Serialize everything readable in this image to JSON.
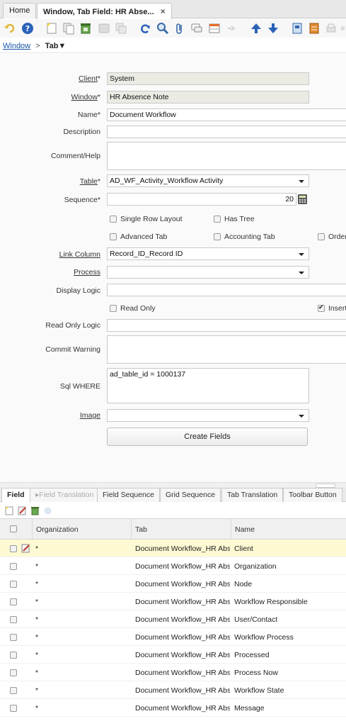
{
  "window_tabs": [
    {
      "label": "Home"
    },
    {
      "label": "Window, Tab Field: HR Abse...",
      "close": "×"
    }
  ],
  "toolbar": {
    "icons": [
      "undo-icon",
      "help-icon",
      "new-record-icon",
      "copy-record-icon",
      "delete-icon",
      "save-icon",
      "save-new-icon",
      "refresh-icon",
      "find-icon",
      "attachment-icon",
      "chat-icon",
      "grid-toggle-icon",
      "detail-icon",
      "previous-record-icon",
      "next-record-icon",
      "report-icon",
      "archive-icon",
      "print-icon",
      "more-icon"
    ]
  },
  "breadcrumb": {
    "root": "Window",
    "sep": ">",
    "current": "Tab▼"
  },
  "form": {
    "client": {
      "label": "Client",
      "req": "*",
      "value": "System"
    },
    "window": {
      "label": "Window",
      "req": "*",
      "value": "HR Absence Note"
    },
    "name": {
      "label": "Name",
      "req": "*",
      "value": "Document Workflow"
    },
    "description": {
      "label": "Description",
      "value": ""
    },
    "comment": {
      "label": "Comment/Help",
      "value": ""
    },
    "table": {
      "label": "Table",
      "req": "*",
      "value": "AD_WF_Activity_Workflow Activity"
    },
    "sequence": {
      "label": "Sequence",
      "req": "*",
      "value": "20"
    },
    "checks_row1": [
      {
        "label": "Single Row Layout",
        "checked": false
      },
      {
        "label": "Has Tree",
        "checked": false
      }
    ],
    "checks_row2": [
      {
        "label": "Advanced Tab",
        "checked": false
      },
      {
        "label": "Accounting Tab",
        "checked": false
      },
      {
        "label": "Order",
        "checked": false
      }
    ],
    "link_column": {
      "label": "Link Column",
      "value": "Record_ID_Record ID"
    },
    "process": {
      "label": "Process",
      "value": ""
    },
    "display_logic": {
      "label": "Display Logic",
      "value": ""
    },
    "checks_row3": [
      {
        "label": "Read Only",
        "checked": false
      },
      {
        "label": "Insert",
        "checked": true
      }
    ],
    "read_only_logic": {
      "label": "Read Only Logic",
      "value": ""
    },
    "commit_warning": {
      "label": "Commit Warning",
      "value": ""
    },
    "sql_where": {
      "label": "Sql WHERE",
      "value": "ad_table_id = 1000137"
    },
    "image": {
      "label": "Image",
      "value": ""
    },
    "create_fields_button": "Create Fields"
  },
  "detail_tabs": [
    {
      "label": "Field",
      "active": true
    },
    {
      "label": "Field Translation",
      "disabled": true
    },
    {
      "label": "Field Sequence"
    },
    {
      "label": "Grid Sequence"
    },
    {
      "label": "Tab Translation"
    },
    {
      "label": "Toolbar Button"
    }
  ],
  "grid": {
    "columns": [
      "Organization",
      "Tab",
      "Name"
    ],
    "rows": [
      {
        "org": "*",
        "tab": "Document Workflow_HR Absen",
        "name": "Client",
        "selected": true
      },
      {
        "org": "*",
        "tab": "Document Workflow_HR Absen",
        "name": "Organization"
      },
      {
        "org": "*",
        "tab": "Document Workflow_HR Absen",
        "name": "Node"
      },
      {
        "org": "*",
        "tab": "Document Workflow_HR Absen",
        "name": "Workflow Responsible"
      },
      {
        "org": "*",
        "tab": "Document Workflow_HR Absen",
        "name": "User/Contact"
      },
      {
        "org": "*",
        "tab": "Document Workflow_HR Absen",
        "name": "Workflow Process"
      },
      {
        "org": "*",
        "tab": "Document Workflow_HR Absen",
        "name": "Processed"
      },
      {
        "org": "*",
        "tab": "Document Workflow_HR Absen",
        "name": "Process Now"
      },
      {
        "org": "*",
        "tab": "Document Workflow_HR Absen",
        "name": "Workflow State"
      },
      {
        "org": "*",
        "tab": "Document Workflow_HR Absen",
        "name": "Message"
      }
    ]
  },
  "colors": {
    "accent": "#1a55a8",
    "selected_row": "#fdfad3"
  }
}
